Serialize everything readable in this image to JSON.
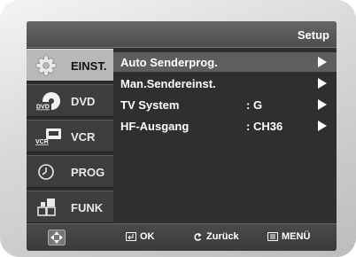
{
  "header": {
    "title": "Setup"
  },
  "sidebar": {
    "items": [
      {
        "label": "EINST.",
        "icon": "gear-icon",
        "active": true
      },
      {
        "label": "DVD",
        "icon": "dvd-disc-icon",
        "active": false
      },
      {
        "label": "VCR",
        "icon": "vcr-tape-icon",
        "active": false
      },
      {
        "label": "PROG",
        "icon": "clock-icon",
        "active": false
      },
      {
        "label": "FUNK",
        "icon": "function-blocks-icon",
        "active": false
      }
    ],
    "dvd_icon_text": "DVD",
    "vcr_icon_text": "VCR"
  },
  "menu": {
    "items": [
      {
        "label": "Auto Senderprog.",
        "value": "",
        "selected": true
      },
      {
        "label": "Man.Sendereinst.",
        "value": "",
        "selected": false
      },
      {
        "label": "TV System",
        "value": ": G",
        "selected": false
      },
      {
        "label": "HF-Ausgang",
        "value": ": CH36",
        "selected": false
      }
    ]
  },
  "footer": {
    "nav_icon": "directional-pad-icon",
    "ok_label": "OK",
    "back_label": "Zurück",
    "menu_label": "MENÜ"
  },
  "colors": {
    "background": "#2c2c2c",
    "selected_row": "#5e5e5e",
    "active_tab": "#b8b8b8",
    "text": "#ffffff"
  }
}
